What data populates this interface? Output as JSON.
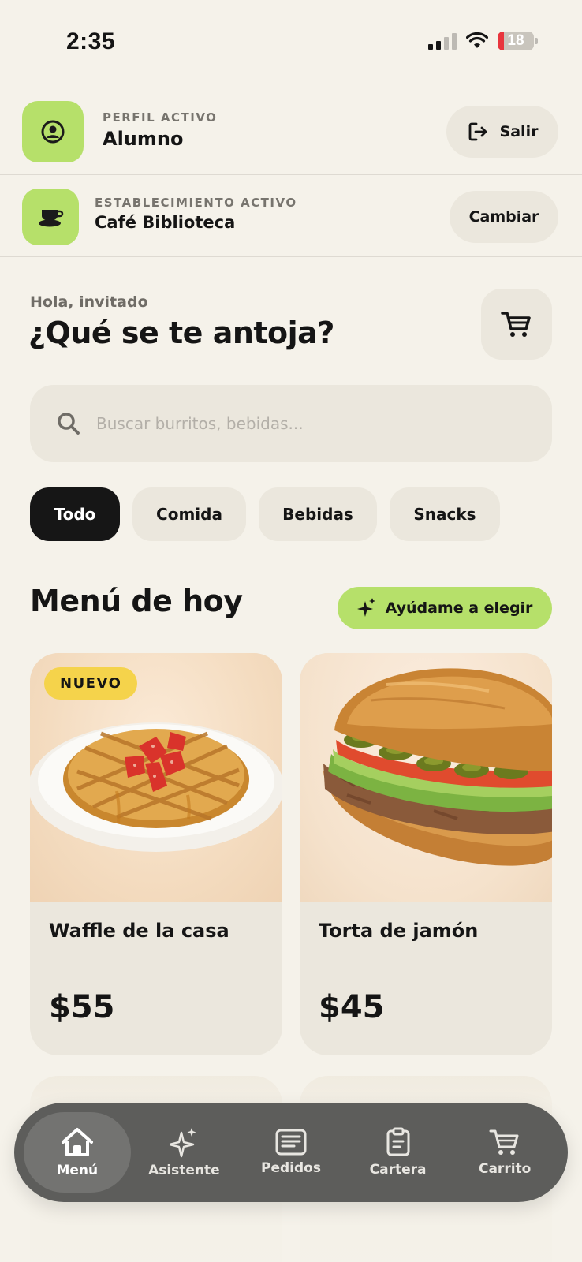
{
  "status_bar": {
    "time": "2:35",
    "battery": "18",
    "battery_level": 0.18
  },
  "profile": {
    "eyebrow": "PERFIL ACTIVO",
    "title": "Alumno",
    "action_label": "Salir"
  },
  "establishment": {
    "eyebrow": "ESTABLECIMIENTO ACTIVO",
    "title": "Café Biblioteca",
    "action_label": "Cambiar"
  },
  "greeting": {
    "small": "Hola, invitado",
    "big": "¿Qué se te antoja?"
  },
  "search": {
    "placeholder": "Buscar burritos, bebidas..."
  },
  "categories": [
    {
      "label": "Todo",
      "active": true
    },
    {
      "label": "Comida",
      "active": false
    },
    {
      "label": "Bebidas",
      "active": false
    },
    {
      "label": "Snacks",
      "active": false
    }
  ],
  "menu": {
    "title": "Menú de hoy",
    "help_label": "Ayúdame a elegir",
    "products": [
      {
        "name": "Waffle de la casa",
        "price": "$55",
        "badge": "NUEVO"
      },
      {
        "name": "Torta de jamón",
        "price": "$45"
      }
    ]
  },
  "nav": [
    {
      "label": "Menú",
      "icon": "home-icon",
      "active": true
    },
    {
      "label": "Asistente",
      "icon": "sparkles-icon",
      "active": false
    },
    {
      "label": "Pedidos",
      "icon": "orders-icon",
      "active": false
    },
    {
      "label": "Cartera",
      "icon": "wallet-icon",
      "active": false
    },
    {
      "label": "Carrito",
      "icon": "cart-icon",
      "active": false
    }
  ],
  "colors": {
    "accent": "#b6e06a",
    "badge": "#f5d34b",
    "background": "#f5f2ea",
    "surface": "#ebe7dd",
    "nav": "#5d5d5b"
  }
}
